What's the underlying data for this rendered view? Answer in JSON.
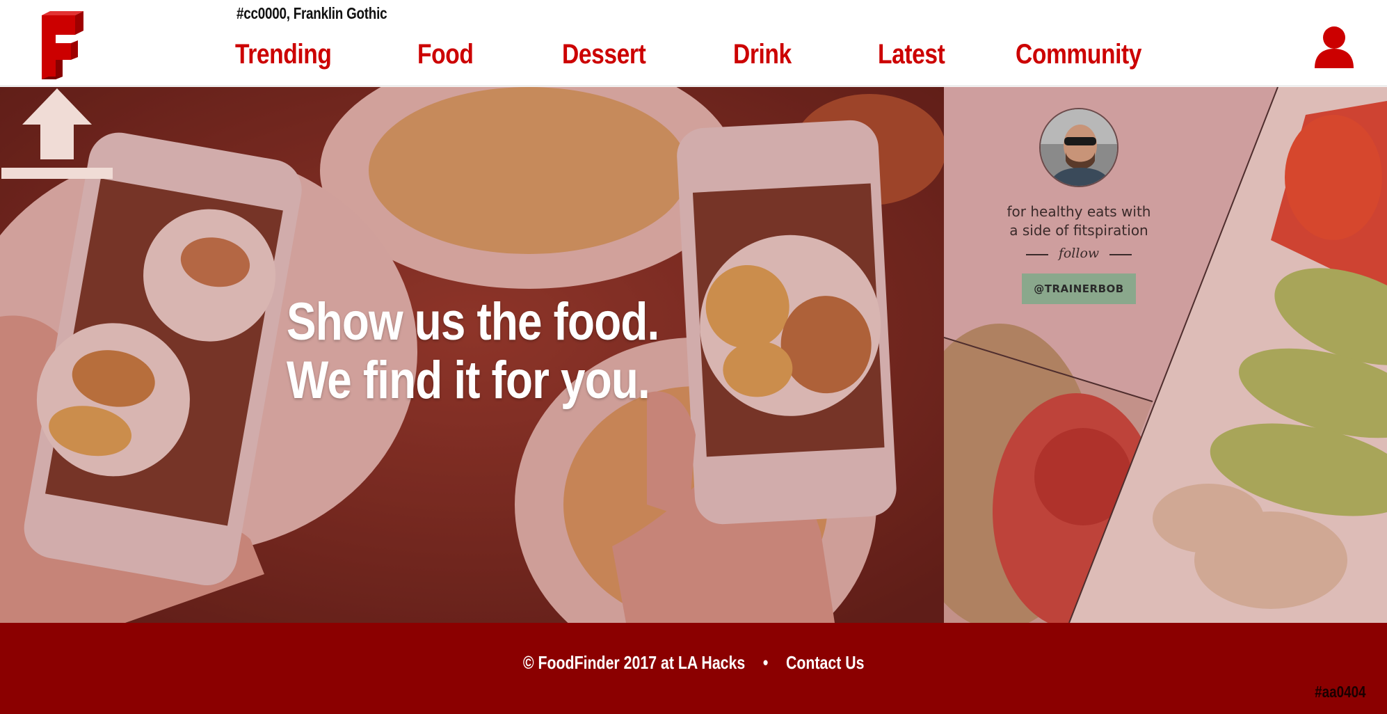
{
  "header": {
    "logo_letter": "F",
    "design_note": "#cc0000, Franklin Gothic",
    "nav": [
      {
        "label": "Trending"
      },
      {
        "label": "Food"
      },
      {
        "label": "Dessert"
      },
      {
        "label": "Drink"
      },
      {
        "label": "Latest"
      },
      {
        "label": "Community"
      }
    ],
    "profile_icon": "user-icon"
  },
  "hero": {
    "headline_line1": "Show us the food.",
    "headline_line2": "We find it for you.",
    "upload_icon": "upload-icon"
  },
  "ad": {
    "tagline_line1": "for healthy eats with",
    "tagline_line2": "a side of fitspiration",
    "follow_label": "follow",
    "handle": "@TRAINERBOB"
  },
  "footer": {
    "copyright": "© FoodFinder 2017 at LA Hacks",
    "separator": "•",
    "contact_label": "Contact Us",
    "color_note": "#aa0404"
  },
  "colors": {
    "brand_red": "#cc0000",
    "footer_red": "#8b0000",
    "header_bg": "#ffffff",
    "ad_button_green": "#8aa88c"
  }
}
